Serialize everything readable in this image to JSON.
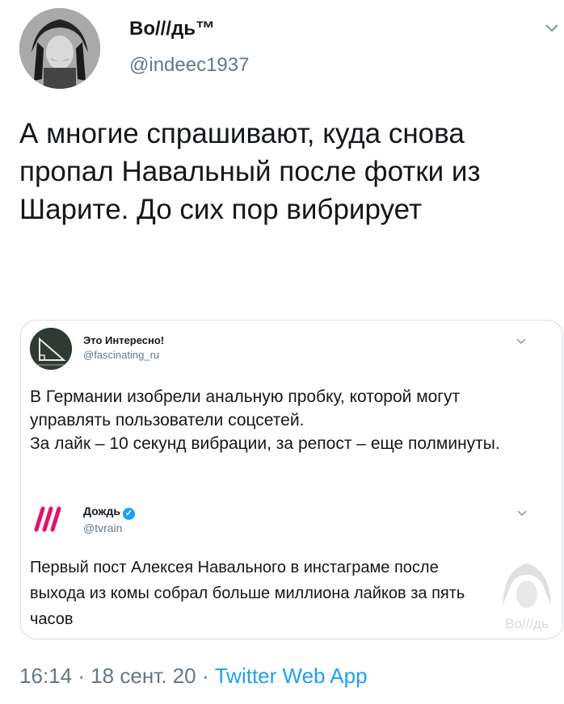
{
  "tweet": {
    "author_name": "Во///дь™",
    "author_handle": "@indeec1937",
    "text": "А многие спрашивают, куда снова пропал Навальный после фотки из Шарите. До сих пор вибрирует",
    "time": "16:14",
    "date": "18 сент. 20",
    "separator": "·",
    "source": "Twitter Web App"
  },
  "quoted": {
    "author_name": "Это Интересно!",
    "author_handle": "@fascinating_ru",
    "text": "В Германии изобрели анальную пробку, которой могут управлять пользователи соцсетей.\nЗа лайк – 10 секунд вибрации, за репост – еще полминуты."
  },
  "retweeted": {
    "author_name": "Дождь",
    "author_handle": "@tvrain",
    "logo_text": "///",
    "text": "Первый пост Алексея Навального в инстаграме после выхода из комы собрал больше миллиона лайков за пять часов"
  },
  "watermark": {
    "text": "Во///дь"
  },
  "icons": {
    "more": "chevron-down-icon",
    "verified": "verified-badge-icon"
  },
  "colors": {
    "secondary": "#657786",
    "link": "#1da1f2",
    "border": "#d4dbe0",
    "tvrain": "#e3126e"
  }
}
